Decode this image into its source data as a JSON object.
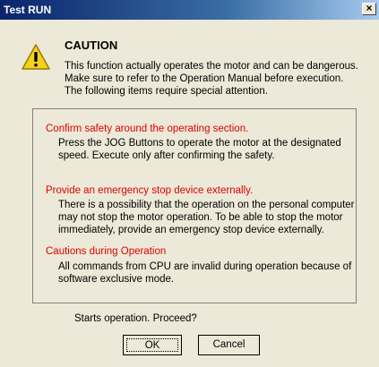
{
  "window": {
    "title": "Test RUN",
    "close_glyph": "×"
  },
  "header": {
    "icon": "warning-triangle-icon",
    "heading": "CAUTION",
    "lines": [
      "This function actually operates the motor and can be dangerous.",
      "Make sure to refer to the Operation Manual before execution.",
      "The following items require special attention."
    ]
  },
  "items": [
    {
      "title": "Confirm safety around the operating section.",
      "lines": [
        "Press the JOG Buttons to operate the motor at the designated",
        "speed. Execute only after confirming the safety."
      ]
    },
    {
      "title": "Provide an emergency stop device externally.",
      "lines": [
        "There is a possibility that the operation on the personal computer",
        "may not stop the motor operation. To be able to stop the motor",
        "immediately, provide an emergency stop device externally."
      ]
    },
    {
      "title": "Cautions during Operation",
      "lines": [
        "All commands from CPU are invalid during operation because of",
        "software exclusive mode."
      ]
    }
  ],
  "prompt": "Starts operation. Proceed?",
  "buttons": {
    "ok": "OK",
    "cancel": "Cancel"
  },
  "colors": {
    "warning_text": "#e00000",
    "title_bar": "#0a246a",
    "dialog_bg": "#ece9d8"
  }
}
